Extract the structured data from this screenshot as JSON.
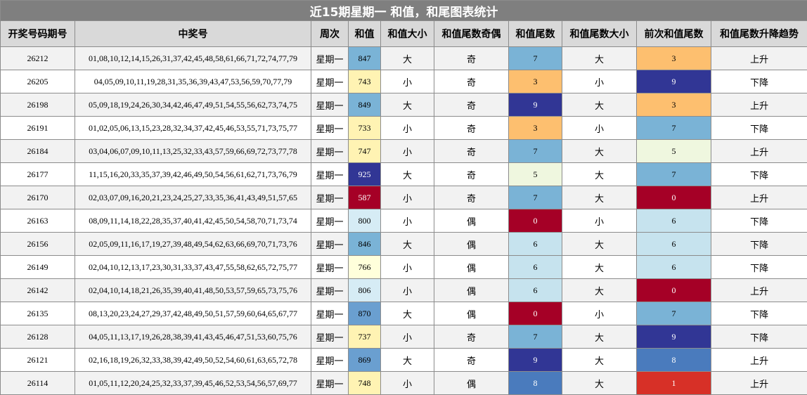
{
  "title": "近15期星期一 和值，和尾图表统计",
  "headers": [
    "开奖号码期号",
    "中奖号",
    "周次",
    "和值",
    "和值大小",
    "和值尾数奇偶",
    "和值尾数",
    "和值尾数大小",
    "前次和值尾数",
    "和值尾数升降趋势"
  ],
  "colors": {
    "sum": {
      "847": "#7ab3d6",
      "743": "#fff3b3",
      "849": "#7ab3d6",
      "733": "#fff3b3",
      "747": "#fff3b3",
      "925": "#313695",
      "587": "#a50026",
      "800": "#d6ecf5",
      "846": "#7ab3d6",
      "766": "#ffffdb",
      "806": "#d6ecf5",
      "870": "#6a9fd0",
      "737": "#fff3b3",
      "869": "#6a9fd0",
      "748": "#fff3b3"
    },
    "digit": {
      "0": "#a50026",
      "1": "#d73027",
      "3": "#fdbf6f",
      "5": "#eff7df",
      "6": "#c6e3ee",
      "7": "#7ab3d6",
      "8": "#4a7bbd",
      "9": "#313695"
    },
    "dark_text": [
      "925",
      "587",
      "0",
      "1",
      "8",
      "9"
    ]
  },
  "rows": [
    {
      "issue": "26212",
      "numbers": "01,08,10,12,14,15,26,31,37,42,45,48,58,61,66,71,72,74,77,79",
      "weekday": "星期一",
      "sum": "847",
      "size": "大",
      "parity": "奇",
      "tail": "7",
      "tail_size": "大",
      "prev_tail": "3",
      "trend": "上升"
    },
    {
      "issue": "26205",
      "numbers": "04,05,09,10,11,19,28,31,35,36,39,43,47,53,56,59,70,77,79",
      "weekday": "星期一",
      "sum": "743",
      "size": "小",
      "parity": "奇",
      "tail": "3",
      "tail_size": "小",
      "prev_tail": "9",
      "trend": "下降"
    },
    {
      "issue": "26198",
      "numbers": "05,09,18,19,24,26,30,34,42,46,47,49,51,54,55,56,62,73,74,75",
      "weekday": "星期一",
      "sum": "849",
      "size": "大",
      "parity": "奇",
      "tail": "9",
      "tail_size": "大",
      "prev_tail": "3",
      "trend": "上升"
    },
    {
      "issue": "26191",
      "numbers": "01,02,05,06,13,15,23,28,32,34,37,42,45,46,53,55,71,73,75,77",
      "weekday": "星期一",
      "sum": "733",
      "size": "小",
      "parity": "奇",
      "tail": "3",
      "tail_size": "小",
      "prev_tail": "7",
      "trend": "下降"
    },
    {
      "issue": "26184",
      "numbers": "03,04,06,07,09,10,11,13,25,32,33,43,57,59,66,69,72,73,77,78",
      "weekday": "星期一",
      "sum": "747",
      "size": "小",
      "parity": "奇",
      "tail": "7",
      "tail_size": "大",
      "prev_tail": "5",
      "trend": "上升"
    },
    {
      "issue": "26177",
      "numbers": "11,15,16,20,33,35,37,39,42,46,49,50,54,56,61,62,71,73,76,79",
      "weekday": "星期一",
      "sum": "925",
      "size": "大",
      "parity": "奇",
      "tail": "5",
      "tail_size": "大",
      "prev_tail": "7",
      "trend": "下降"
    },
    {
      "issue": "26170",
      "numbers": "02,03,07,09,16,20,21,23,24,25,27,33,35,36,41,43,49,51,57,65",
      "weekday": "星期一",
      "sum": "587",
      "size": "小",
      "parity": "奇",
      "tail": "7",
      "tail_size": "大",
      "prev_tail": "0",
      "trend": "上升"
    },
    {
      "issue": "26163",
      "numbers": "08,09,11,14,18,22,28,35,37,40,41,42,45,50,54,58,70,71,73,74",
      "weekday": "星期一",
      "sum": "800",
      "size": "小",
      "parity": "偶",
      "tail": "0",
      "tail_size": "小",
      "prev_tail": "6",
      "trend": "下降"
    },
    {
      "issue": "26156",
      "numbers": "02,05,09,11,16,17,19,27,39,48,49,54,62,63,66,69,70,71,73,76",
      "weekday": "星期一",
      "sum": "846",
      "size": "大",
      "parity": "偶",
      "tail": "6",
      "tail_size": "大",
      "prev_tail": "6",
      "trend": "下降"
    },
    {
      "issue": "26149",
      "numbers": "02,04,10,12,13,17,23,30,31,33,37,43,47,55,58,62,65,72,75,77",
      "weekday": "星期一",
      "sum": "766",
      "size": "小",
      "parity": "偶",
      "tail": "6",
      "tail_size": "大",
      "prev_tail": "6",
      "trend": "下降"
    },
    {
      "issue": "26142",
      "numbers": "02,04,10,14,18,21,26,35,39,40,41,48,50,53,57,59,65,73,75,76",
      "weekday": "星期一",
      "sum": "806",
      "size": "小",
      "parity": "偶",
      "tail": "6",
      "tail_size": "大",
      "prev_tail": "0",
      "trend": "上升"
    },
    {
      "issue": "26135",
      "numbers": "08,13,20,23,24,27,29,37,42,48,49,50,51,57,59,60,64,65,67,77",
      "weekday": "星期一",
      "sum": "870",
      "size": "大",
      "parity": "偶",
      "tail": "0",
      "tail_size": "小",
      "prev_tail": "7",
      "trend": "下降"
    },
    {
      "issue": "26128",
      "numbers": "04,05,11,13,17,19,26,28,38,39,41,43,45,46,47,51,53,60,75,76",
      "weekday": "星期一",
      "sum": "737",
      "size": "小",
      "parity": "奇",
      "tail": "7",
      "tail_size": "大",
      "prev_tail": "9",
      "trend": "下降"
    },
    {
      "issue": "26121",
      "numbers": "02,16,18,19,26,32,33,38,39,42,49,50,52,54,60,61,63,65,72,78",
      "weekday": "星期一",
      "sum": "869",
      "size": "大",
      "parity": "奇",
      "tail": "9",
      "tail_size": "大",
      "prev_tail": "8",
      "trend": "上升"
    },
    {
      "issue": "26114",
      "numbers": "01,05,11,12,20,24,25,32,33,37,39,45,46,52,53,54,56,57,69,77",
      "weekday": "星期一",
      "sum": "748",
      "size": "小",
      "parity": "偶",
      "tail": "8",
      "tail_size": "大",
      "prev_tail": "1",
      "trend": "上升"
    }
  ]
}
